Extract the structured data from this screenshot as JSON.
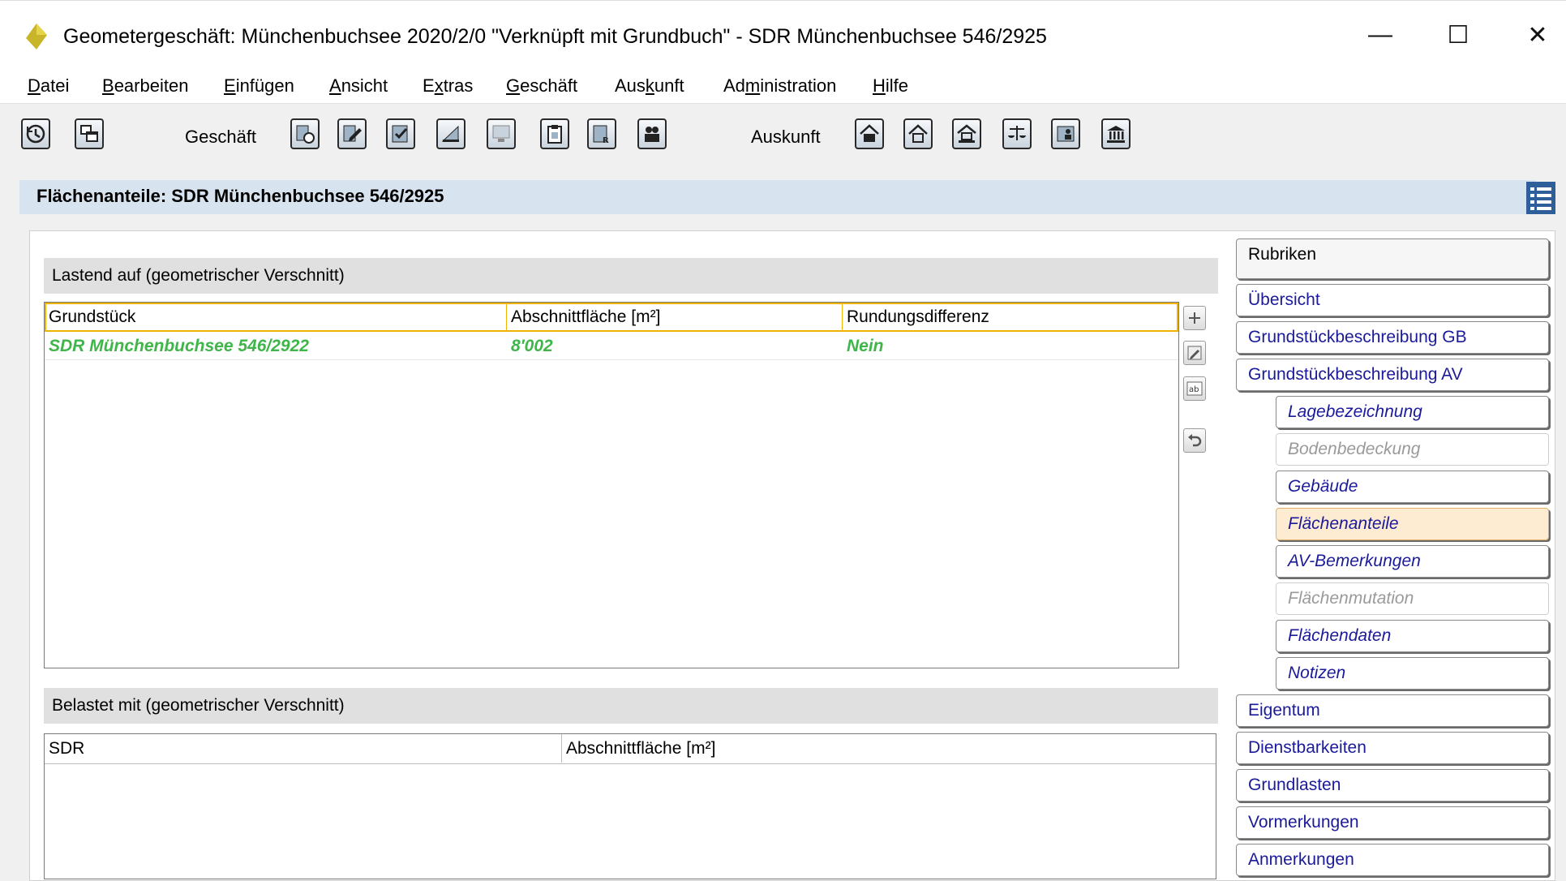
{
  "window": {
    "title": "Geometergeschäft: Münchenbuchsee 2020/2/0 \"Verknüpft mit Grundbuch\"  - SDR Münchenbuchsee 546/2925",
    "minimize": "—",
    "maximize": "☐",
    "close": "✕"
  },
  "menu": [
    {
      "pre": "",
      "u": "D",
      "post": "atei"
    },
    {
      "pre": "",
      "u": "B",
      "post": "earbeiten"
    },
    {
      "pre": "",
      "u": "E",
      "post": "infügen"
    },
    {
      "pre": "",
      "u": "A",
      "post": "nsicht"
    },
    {
      "pre": "E",
      "u": "x",
      "post": "tras"
    },
    {
      "pre": "",
      "u": "G",
      "post": "eschäft"
    },
    {
      "pre": "Aus",
      "u": "k",
      "post": "unft"
    },
    {
      "pre": "Ad",
      "u": "m",
      "post": "inistration"
    },
    {
      "pre": "",
      "u": "H",
      "post": "ilfe"
    }
  ],
  "toolbar": {
    "geschaeft_label": "Geschäft",
    "auskunft_label": "Auskunft",
    "icons_left": [
      "history-icon",
      "window-tile-icon"
    ],
    "icons_geschaeft": [
      "report-clock-icon",
      "document-edit-icon",
      "checklist-icon",
      "ruler-icon",
      "monitor-icon",
      "clipboard-icon",
      "report-search-icon",
      "people-icon"
    ],
    "icons_auskunft": [
      "house-icon",
      "house-outline-icon",
      "house-columns-icon",
      "scales-icon",
      "person-card-icon",
      "bank-icon"
    ]
  },
  "header": {
    "title": "Flächenanteile: SDR Münchenbuchsee 546/2925"
  },
  "section1": {
    "title": "Lastend auf (geometrischer Verschnitt)",
    "columns": [
      "Grundstück",
      "Abschnittfläche [m²]",
      "Rundungsdifferenz"
    ],
    "rows": [
      [
        "SDR Münchenbuchsee 546/2922",
        "8'002",
        "Nein"
      ]
    ]
  },
  "section2": {
    "title": "Belastet mit (geometrischer Verschnitt)",
    "columns": [
      "SDR",
      "Abschnittfläche [m²]"
    ]
  },
  "rubriken": {
    "title": "Rubriken",
    "items": [
      {
        "label": "Übersicht",
        "level": "main",
        "state": "normal"
      },
      {
        "label": "Grundstückbeschreibung GB",
        "level": "main",
        "state": "normal"
      },
      {
        "label": "Grundstückbeschreibung AV",
        "level": "main",
        "state": "normal"
      },
      {
        "label": "Lagebezeichnung",
        "level": "sub",
        "state": "normal"
      },
      {
        "label": "Bodenbedeckung",
        "level": "sub",
        "state": "disabled"
      },
      {
        "label": "Gebäude",
        "level": "sub",
        "state": "normal"
      },
      {
        "label": "Flächenanteile",
        "level": "sub",
        "state": "active"
      },
      {
        "label": "AV-Bemerkungen",
        "level": "sub",
        "state": "normal"
      },
      {
        "label": "Flächenmutation",
        "level": "sub",
        "state": "disabled"
      },
      {
        "label": "Flächendaten",
        "level": "sub",
        "state": "normal"
      },
      {
        "label": "Notizen",
        "level": "sub",
        "state": "normal"
      },
      {
        "label": "Eigentum",
        "level": "main",
        "state": "normal"
      },
      {
        "label": "Dienstbarkeiten",
        "level": "main",
        "state": "normal"
      },
      {
        "label": "Grundlasten",
        "level": "main",
        "state": "normal"
      },
      {
        "label": "Vormerkungen",
        "level": "main",
        "state": "normal"
      },
      {
        "label": "Anmerkungen",
        "level": "main",
        "state": "normal"
      }
    ]
  },
  "colors": {
    "accent_green": "#3fb54a",
    "header_blue": "#d7e3ef",
    "active_tab": "#fdebd2",
    "link_blue": "#1a1a9a"
  }
}
